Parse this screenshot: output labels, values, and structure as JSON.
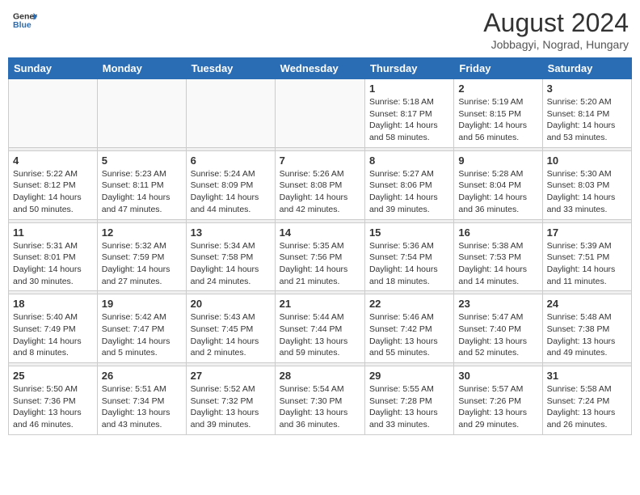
{
  "header": {
    "logo_general": "General",
    "logo_blue": "Blue",
    "month_year": "August 2024",
    "location": "Jobbagyi, Nograd, Hungary"
  },
  "days_of_week": [
    "Sunday",
    "Monday",
    "Tuesday",
    "Wednesday",
    "Thursday",
    "Friday",
    "Saturday"
  ],
  "weeks": [
    [
      {
        "day": "",
        "info": ""
      },
      {
        "day": "",
        "info": ""
      },
      {
        "day": "",
        "info": ""
      },
      {
        "day": "",
        "info": ""
      },
      {
        "day": "1",
        "info": "Sunrise: 5:18 AM\nSunset: 8:17 PM\nDaylight: 14 hours\nand 58 minutes."
      },
      {
        "day": "2",
        "info": "Sunrise: 5:19 AM\nSunset: 8:15 PM\nDaylight: 14 hours\nand 56 minutes."
      },
      {
        "day": "3",
        "info": "Sunrise: 5:20 AM\nSunset: 8:14 PM\nDaylight: 14 hours\nand 53 minutes."
      }
    ],
    [
      {
        "day": "4",
        "info": "Sunrise: 5:22 AM\nSunset: 8:12 PM\nDaylight: 14 hours\nand 50 minutes."
      },
      {
        "day": "5",
        "info": "Sunrise: 5:23 AM\nSunset: 8:11 PM\nDaylight: 14 hours\nand 47 minutes."
      },
      {
        "day": "6",
        "info": "Sunrise: 5:24 AM\nSunset: 8:09 PM\nDaylight: 14 hours\nand 44 minutes."
      },
      {
        "day": "7",
        "info": "Sunrise: 5:26 AM\nSunset: 8:08 PM\nDaylight: 14 hours\nand 42 minutes."
      },
      {
        "day": "8",
        "info": "Sunrise: 5:27 AM\nSunset: 8:06 PM\nDaylight: 14 hours\nand 39 minutes."
      },
      {
        "day": "9",
        "info": "Sunrise: 5:28 AM\nSunset: 8:04 PM\nDaylight: 14 hours\nand 36 minutes."
      },
      {
        "day": "10",
        "info": "Sunrise: 5:30 AM\nSunset: 8:03 PM\nDaylight: 14 hours\nand 33 minutes."
      }
    ],
    [
      {
        "day": "11",
        "info": "Sunrise: 5:31 AM\nSunset: 8:01 PM\nDaylight: 14 hours\nand 30 minutes."
      },
      {
        "day": "12",
        "info": "Sunrise: 5:32 AM\nSunset: 7:59 PM\nDaylight: 14 hours\nand 27 minutes."
      },
      {
        "day": "13",
        "info": "Sunrise: 5:34 AM\nSunset: 7:58 PM\nDaylight: 14 hours\nand 24 minutes."
      },
      {
        "day": "14",
        "info": "Sunrise: 5:35 AM\nSunset: 7:56 PM\nDaylight: 14 hours\nand 21 minutes."
      },
      {
        "day": "15",
        "info": "Sunrise: 5:36 AM\nSunset: 7:54 PM\nDaylight: 14 hours\nand 18 minutes."
      },
      {
        "day": "16",
        "info": "Sunrise: 5:38 AM\nSunset: 7:53 PM\nDaylight: 14 hours\nand 14 minutes."
      },
      {
        "day": "17",
        "info": "Sunrise: 5:39 AM\nSunset: 7:51 PM\nDaylight: 14 hours\nand 11 minutes."
      }
    ],
    [
      {
        "day": "18",
        "info": "Sunrise: 5:40 AM\nSunset: 7:49 PM\nDaylight: 14 hours\nand 8 minutes."
      },
      {
        "day": "19",
        "info": "Sunrise: 5:42 AM\nSunset: 7:47 PM\nDaylight: 14 hours\nand 5 minutes."
      },
      {
        "day": "20",
        "info": "Sunrise: 5:43 AM\nSunset: 7:45 PM\nDaylight: 14 hours\nand 2 minutes."
      },
      {
        "day": "21",
        "info": "Sunrise: 5:44 AM\nSunset: 7:44 PM\nDaylight: 13 hours\nand 59 minutes."
      },
      {
        "day": "22",
        "info": "Sunrise: 5:46 AM\nSunset: 7:42 PM\nDaylight: 13 hours\nand 55 minutes."
      },
      {
        "day": "23",
        "info": "Sunrise: 5:47 AM\nSunset: 7:40 PM\nDaylight: 13 hours\nand 52 minutes."
      },
      {
        "day": "24",
        "info": "Sunrise: 5:48 AM\nSunset: 7:38 PM\nDaylight: 13 hours\nand 49 minutes."
      }
    ],
    [
      {
        "day": "25",
        "info": "Sunrise: 5:50 AM\nSunset: 7:36 PM\nDaylight: 13 hours\nand 46 minutes."
      },
      {
        "day": "26",
        "info": "Sunrise: 5:51 AM\nSunset: 7:34 PM\nDaylight: 13 hours\nand 43 minutes."
      },
      {
        "day": "27",
        "info": "Sunrise: 5:52 AM\nSunset: 7:32 PM\nDaylight: 13 hours\nand 39 minutes."
      },
      {
        "day": "28",
        "info": "Sunrise: 5:54 AM\nSunset: 7:30 PM\nDaylight: 13 hours\nand 36 minutes."
      },
      {
        "day": "29",
        "info": "Sunrise: 5:55 AM\nSunset: 7:28 PM\nDaylight: 13 hours\nand 33 minutes."
      },
      {
        "day": "30",
        "info": "Sunrise: 5:57 AM\nSunset: 7:26 PM\nDaylight: 13 hours\nand 29 minutes."
      },
      {
        "day": "31",
        "info": "Sunrise: 5:58 AM\nSunset: 7:24 PM\nDaylight: 13 hours\nand 26 minutes."
      }
    ]
  ]
}
